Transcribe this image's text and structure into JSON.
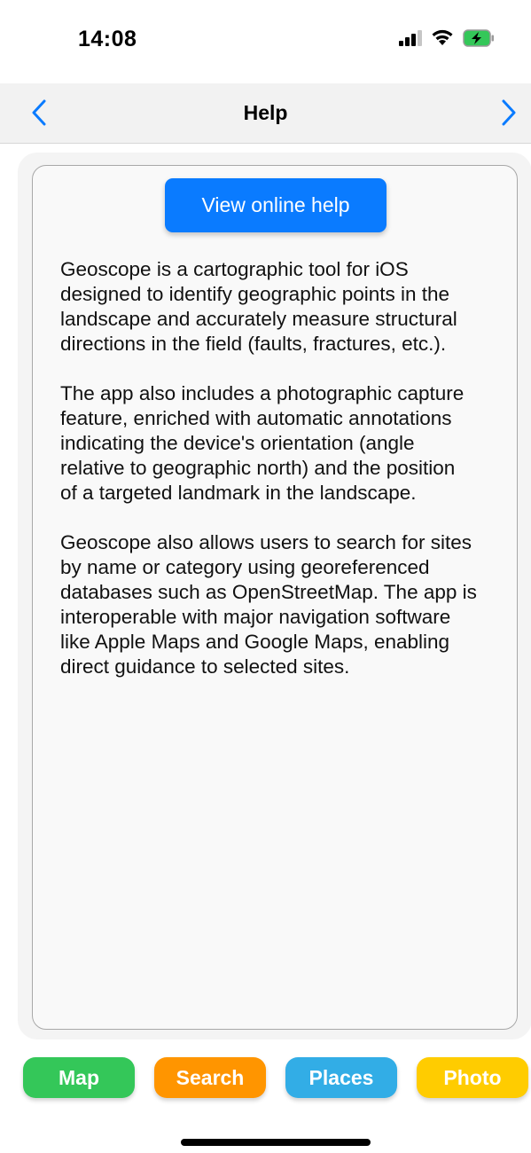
{
  "status_bar": {
    "time": "14:08",
    "icons": [
      "signal-icon",
      "wifi-icon",
      "battery-charging-icon"
    ]
  },
  "nav": {
    "title": "Help",
    "back_icon": "chevron-left-icon",
    "forward_icon": "chevron-right-icon",
    "accent_color": "#0a7bff"
  },
  "help": {
    "button_label": "View online help",
    "paragraphs": [
      "Geoscope is a cartographic tool for iOS designed to identify geographic points in the landscape and accurately measure structural directions in the field (faults, fractures, etc.).",
      "The app also includes a photographic capture feature, enriched with automatic annotations indicating the device's orientation (angle relative to geographic north) and the position of a targeted landmark in the landscape.",
      "Geoscope also allows users to search for sites by name or category using georeferenced databases such as OpenStreetMap. The app is interoperable with major navigation software like Apple Maps and Google Maps, enabling direct guidance to selected sites."
    ]
  },
  "tabs": [
    {
      "label": "Map",
      "color": "#34c759"
    },
    {
      "label": "Search",
      "color": "#ff9500"
    },
    {
      "label": "Places",
      "color": "#32ade6"
    },
    {
      "label": "Photo",
      "color": "#ffcc00"
    }
  ]
}
